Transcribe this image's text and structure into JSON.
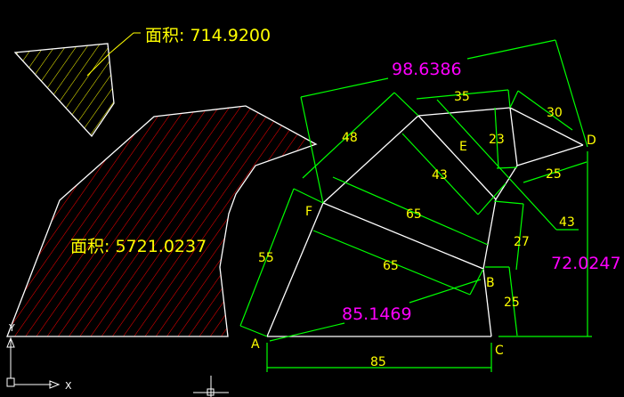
{
  "colors": {
    "background": "#000000",
    "geometry": "#ffffff",
    "dimension": "#00ff00",
    "dim_text": "#ffff00",
    "total_text": "#ff00ff",
    "hatch_large": "#ff0000",
    "hatch_small": "#ffff00"
  },
  "areas": {
    "small": {
      "label": "面积:",
      "value": "714.9200"
    },
    "large": {
      "label": "面积:",
      "value": "5721.0237"
    }
  },
  "points": {
    "A": "A",
    "B": "B",
    "C": "C",
    "D": "D",
    "E": "E",
    "F": "F"
  },
  "dims": {
    "af": "55",
    "fb_lower": "65",
    "fb_upper": "65",
    "ac": "85",
    "fe": "48",
    "e_top": "35",
    "e_d": "30",
    "e_vert": "23",
    "e_diag": "43",
    "d_low": "25",
    "b_up": "27",
    "b_c": "25",
    "side_43": "43",
    "total_top": "98.6386",
    "total_right": "72.0247",
    "total_ab": "85.1469"
  },
  "ucs": {
    "x_label": "X",
    "y_label": "Y"
  }
}
